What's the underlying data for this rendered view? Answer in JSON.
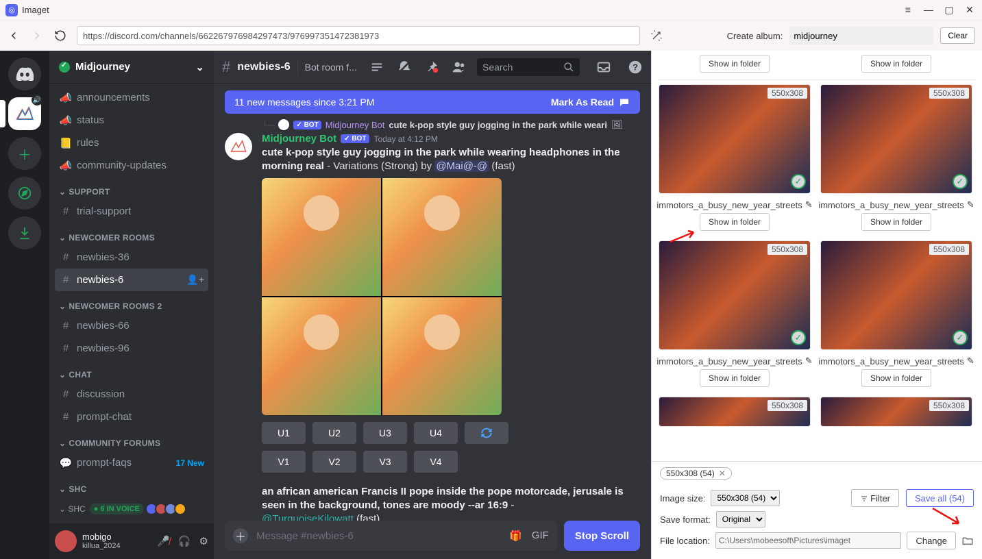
{
  "app": {
    "title": "Imaget"
  },
  "nav": {
    "url": "https://discord.com/channels/662267976984297473/976997351472381973"
  },
  "album": {
    "label": "Create album:",
    "value": "midjourney",
    "clear": "Clear"
  },
  "server": {
    "name": "Midjourney"
  },
  "categories": [
    {
      "name": "",
      "channels": [
        {
          "icon": "📣",
          "label": "announcements"
        },
        {
          "icon": "📣",
          "label": "status"
        },
        {
          "icon": "📒",
          "label": "rules"
        },
        {
          "icon": "📣",
          "label": "community-updates"
        }
      ]
    },
    {
      "name": "SUPPORT",
      "channels": [
        {
          "icon": "#",
          "label": "trial-support"
        }
      ]
    },
    {
      "name": "NEWCOMER ROOMS",
      "channels": [
        {
          "icon": "#",
          "label": "newbies-36"
        },
        {
          "icon": "#",
          "label": "newbies-6",
          "active": true
        }
      ]
    },
    {
      "name": "NEWCOMER ROOMS 2",
      "channels": [
        {
          "icon": "#",
          "label": "newbies-66"
        },
        {
          "icon": "#",
          "label": "newbies-96"
        }
      ]
    },
    {
      "name": "CHAT",
      "channels": [
        {
          "icon": "#",
          "label": "discussion"
        },
        {
          "icon": "#",
          "label": "prompt-chat"
        }
      ]
    },
    {
      "name": "COMMUNITY FORUMS",
      "channels": [
        {
          "icon": "💬",
          "label": "prompt-faqs",
          "new": "17 New"
        }
      ]
    },
    {
      "name": "SHC",
      "channels": []
    }
  ],
  "voice": {
    "label": "6 IN VOICE"
  },
  "user": {
    "name": "mobigo",
    "tag": "killua_2024"
  },
  "chat": {
    "channel": "newbies-6",
    "topic": "Bot room f...",
    "search_placeholder": "Search",
    "newbar": "11 new messages since 3:21 PM",
    "mark": "Mark As Read",
    "reply_bot": "Midjourney Bot",
    "reply_text": "cute k-pop style guy jogging in the park while weari",
    "author": "Midjourney Bot",
    "bot_pill": "✓ BOT",
    "timestamp": "Today at 4:12 PM",
    "prompt_bold": "cute k-pop style guy jogging in the park while wearing headphones in the morning real",
    "prompt_tail": " - Variations (Strong) by ",
    "prompt_mention": "@Mai@-@",
    "prompt_mode": " (fast)",
    "buttons_u": [
      "U1",
      "U2",
      "U3",
      "U4"
    ],
    "buttons_v": [
      "V1",
      "V2",
      "V3",
      "V4"
    ],
    "msg2_bold": "an african american Francis II pope inside the pope motorcade, jerusale is seen in the background, tones are moody --ar 16:9",
    "msg2_mention": "@TurquoiseKilowatt",
    "msg2_mode": " (fast)",
    "input_placeholder": "Message #newbies-6",
    "stop": "Stop Scroll"
  },
  "thumbs": {
    "dim": "550x308",
    "filename": "immotors_a_busy_new_year_streets",
    "show": "Show in folder"
  },
  "footer": {
    "chip": "550x308 (54)",
    "imgsize_label": "Image size:",
    "imgsize_value": "550x308 (54)",
    "filter": "Filter",
    "saveall": "Save all (54)",
    "savefmt_label": "Save format:",
    "savefmt_value": "Original",
    "loc_label": "File location:",
    "loc_value": "C:\\Users\\mobeesoft\\Pictures\\imaget",
    "change": "Change"
  }
}
